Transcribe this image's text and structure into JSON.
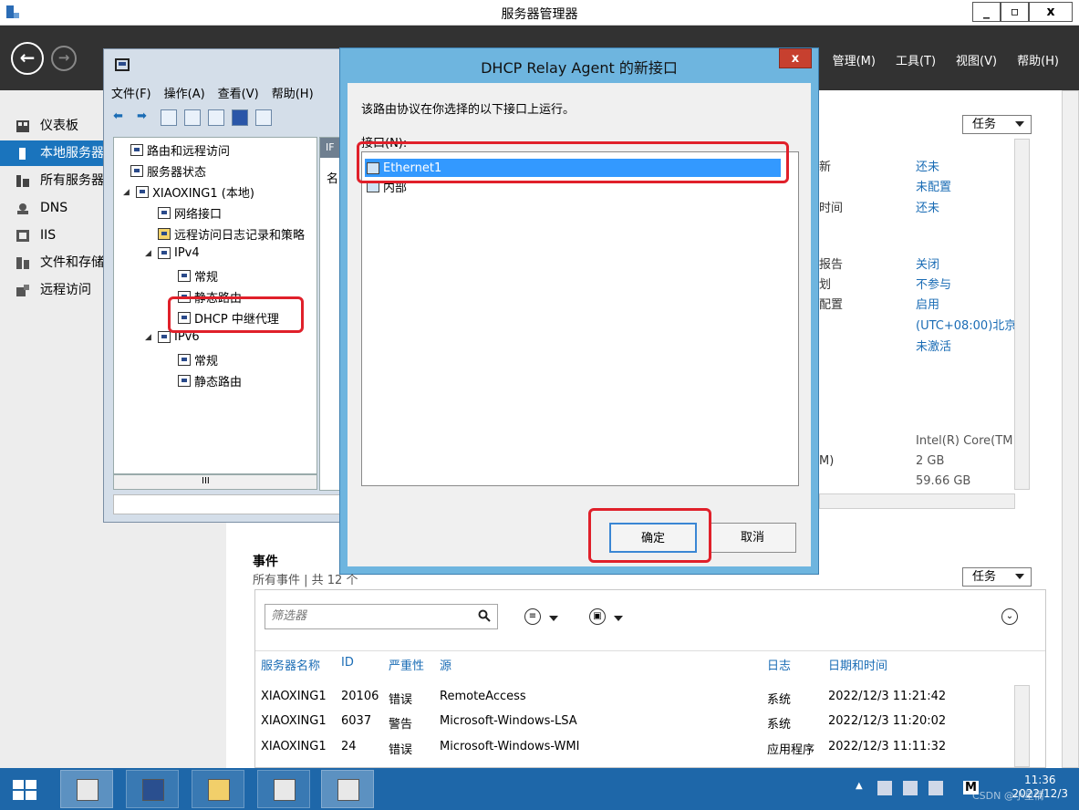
{
  "window": {
    "title": "服务器管理器",
    "min_btn": "_",
    "max_btn": "▫",
    "close_btn": "x"
  },
  "navbar": {
    "back": "←",
    "forward": "→",
    "menus": [
      "管理(M)",
      "工具(T)",
      "视图(V)",
      "帮助(H)"
    ]
  },
  "sidebar": {
    "items": [
      {
        "label": "仪表板",
        "icon": "dashboard-icon"
      },
      {
        "label": "本地服务器",
        "icon": "server-icon",
        "active": true
      },
      {
        "label": "所有服务器",
        "icon": "servers-icon"
      },
      {
        "label": "DNS",
        "icon": "dns-icon"
      },
      {
        "label": "IIS",
        "icon": "iis-icon"
      },
      {
        "label": "文件和存储",
        "icon": "storage-icon"
      },
      {
        "label": "远程访问",
        "icon": "remote-access-icon"
      }
    ]
  },
  "properties": {
    "tasks": "任务",
    "rows": [
      {
        "label": "新",
        "value": "还未"
      },
      {
        "label": "",
        "value": "未配置"
      },
      {
        "label": "时间",
        "value": "还未"
      },
      {
        "label": "报告",
        "value": "关闭"
      },
      {
        "label": "划",
        "value": "不参与"
      },
      {
        "label": "配置",
        "value": "启用"
      },
      {
        "label": "",
        "value": "(UTC+08:00)北京"
      },
      {
        "label": "",
        "value": "未激活"
      },
      {
        "label": "",
        "value": "Intel(R) Core(TM"
      },
      {
        "label": "M)",
        "value": "2 GB"
      },
      {
        "label": "",
        "value": "59.66 GB"
      }
    ]
  },
  "rras": {
    "menus": [
      "文件(F)",
      "操作(A)",
      "查看(V)",
      "帮助(H)"
    ],
    "tree": [
      {
        "label": "路由和远程访问",
        "level": 0,
        "toggle": ""
      },
      {
        "label": "服务器状态",
        "level": 1,
        "toggle": ""
      },
      {
        "label": "XIAOXING1 (本地)",
        "level": 1,
        "toggle": "◢"
      },
      {
        "label": "网络接口",
        "level": 2,
        "toggle": ""
      },
      {
        "label": "远程访问日志记录和策略",
        "level": 2,
        "toggle": ""
      },
      {
        "label": "IPv4",
        "level": 2,
        "toggle": "◢"
      },
      {
        "label": "常规",
        "level": 3,
        "toggle": ""
      },
      {
        "label": "静态路由",
        "level": 3,
        "toggle": ""
      },
      {
        "label": "DHCP 中继代理",
        "level": 3,
        "toggle": ""
      },
      {
        "label": "IPv6",
        "level": 2,
        "toggle": "◢"
      },
      {
        "label": "常规",
        "level": 3,
        "toggle": ""
      },
      {
        "label": "静态路由",
        "level": 3,
        "toggle": ""
      }
    ],
    "right_header": "IF",
    "right_col": "名",
    "scroll_mid": "III"
  },
  "dialog": {
    "title": "DHCP Relay Agent 的新接口",
    "close": "x",
    "description": "该路由协议在你选择的以下接口上运行。",
    "list_label": "接口(N):",
    "interfaces": [
      {
        "name": "Ethernet1",
        "selected": true
      },
      {
        "name": "内部",
        "selected": false
      }
    ],
    "ok": "确定",
    "cancel": "取消"
  },
  "events": {
    "title": "事件",
    "subtitle": "所有事件 | 共 12 个",
    "tasks": "任务",
    "filter_placeholder": "筛选器",
    "columns": [
      "服务器名称",
      "ID",
      "严重性",
      "源",
      "日志",
      "日期和时间"
    ],
    "rows": [
      [
        "XIAOXING1",
        "20106",
        "错误",
        "RemoteAccess",
        "系统",
        "2022/12/3 11:21:42"
      ],
      [
        "XIAOXING1",
        "6037",
        "警告",
        "Microsoft-Windows-LSA",
        "系统",
        "2022/12/3 11:20:02"
      ],
      [
        "XIAOXING1",
        "24",
        "错误",
        "Microsoft-Windows-WMI",
        "应用程序",
        "2022/12/3 11:11:32"
      ]
    ]
  },
  "taskbar": {
    "time": "11:36",
    "date": "2022/12/3",
    "tray_text": "M",
    "watermark": "CSDN @小星情"
  },
  "colors": {
    "accent": "#1a74bd",
    "navbar": "#323232",
    "dialog_frame": "#6eb5df",
    "selection": "#3399ff",
    "highlight_box": "#e0202a",
    "taskbar": "#1e67a9"
  }
}
